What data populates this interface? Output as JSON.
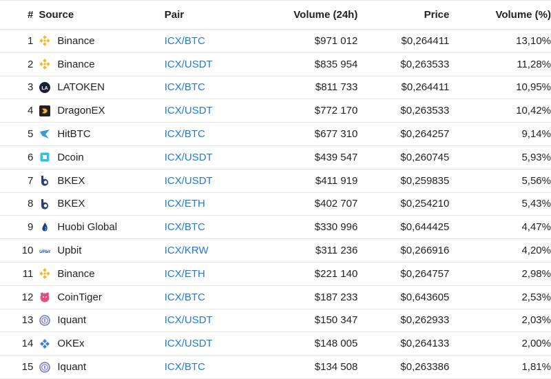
{
  "headers": {
    "rank": "#",
    "source": "Source",
    "pair": "Pair",
    "volume": "Volume (24h)",
    "price": "Price",
    "volume_pct": "Volume (%)"
  },
  "colors": {
    "link": "#1f7ad8",
    "binance": "#f3ba2f",
    "border": "#e6e6e6"
  },
  "rows": [
    {
      "rank": "1",
      "source": "Binance",
      "icon": "binance-icon",
      "pair": "ICX/BTC",
      "volume": "$971 012",
      "price": "$0,264411",
      "pct": "13,10%"
    },
    {
      "rank": "2",
      "source": "Binance",
      "icon": "binance-icon",
      "pair": "ICX/USDT",
      "volume": "$835 954",
      "price": "$0,263533",
      "pct": "11,28%"
    },
    {
      "rank": "3",
      "source": "LATOKEN",
      "icon": "latoken-icon",
      "pair": "ICX/BTC",
      "volume": "$811 733",
      "price": "$0,264411",
      "pct": "10,95%"
    },
    {
      "rank": "4",
      "source": "DragonEX",
      "icon": "dragonex-icon",
      "pair": "ICX/USDT",
      "volume": "$772 170",
      "price": "$0,263533",
      "pct": "10,42%"
    },
    {
      "rank": "5",
      "source": "HitBTC",
      "icon": "hitbtc-icon",
      "pair": "ICX/BTC",
      "volume": "$677 310",
      "price": "$0,264257",
      "pct": "9,14%"
    },
    {
      "rank": "6",
      "source": "Dcoin",
      "icon": "dcoin-icon",
      "pair": "ICX/USDT",
      "volume": "$439 547",
      "price": "$0,260745",
      "pct": "5,93%"
    },
    {
      "rank": "7",
      "source": "BKEX",
      "icon": "bkex-icon",
      "pair": "ICX/USDT",
      "volume": "$411 919",
      "price": "$0,259835",
      "pct": "5,56%"
    },
    {
      "rank": "8",
      "source": "BKEX",
      "icon": "bkex-icon",
      "pair": "ICX/ETH",
      "volume": "$402 707",
      "price": "$0,254210",
      "pct": "5,43%"
    },
    {
      "rank": "9",
      "source": "Huobi Global",
      "icon": "huobi-icon",
      "pair": "ICX/BTC",
      "volume": "$330 996",
      "price": "$0,644425",
      "pct": "4,47%"
    },
    {
      "rank": "10",
      "source": "Upbit",
      "icon": "upbit-icon",
      "pair": "ICX/KRW",
      "volume": "$311 236",
      "price": "$0,266916",
      "pct": "4,20%"
    },
    {
      "rank": "11",
      "source": "Binance",
      "icon": "binance-icon",
      "pair": "ICX/ETH",
      "volume": "$221 140",
      "price": "$0,264757",
      "pct": "2,98%"
    },
    {
      "rank": "12",
      "source": "CoinTiger",
      "icon": "cointiger-icon",
      "pair": "ICX/BTC",
      "volume": "$187 233",
      "price": "$0,643605",
      "pct": "2,53%"
    },
    {
      "rank": "13",
      "source": "Iquant",
      "icon": "iquant-icon",
      "pair": "ICX/USDT",
      "volume": "$150 347",
      "price": "$0,262933",
      "pct": "2,03%"
    },
    {
      "rank": "14",
      "source": "OKEx",
      "icon": "okex-icon",
      "pair": "ICX/USDT",
      "volume": "$148 005",
      "price": "$0,264133",
      "pct": "2,00%"
    },
    {
      "rank": "15",
      "source": "Iquant",
      "icon": "iquant-icon",
      "pair": "ICX/BTC",
      "volume": "$134 508",
      "price": "$0,263386",
      "pct": "1,81%"
    }
  ]
}
